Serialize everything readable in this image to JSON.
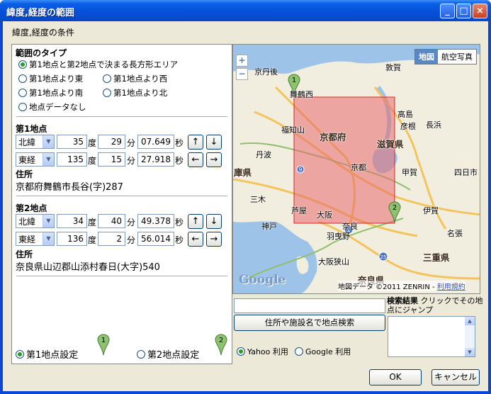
{
  "window": {
    "title": "緯度,経度の範囲"
  },
  "condition_label": "緯度,経度の条件",
  "range_type": {
    "title": "範囲のタイプ",
    "options": [
      {
        "label": "第1地点と第2地点で決まる長方形エリア",
        "selected": true
      },
      {
        "label": "第1地点より東",
        "selected": false
      },
      {
        "label": "第1地点より西",
        "selected": false
      },
      {
        "label": "第1地点より南",
        "selected": false
      },
      {
        "label": "第1地点より北",
        "selected": false
      },
      {
        "label": "地点データなし",
        "selected": false
      }
    ]
  },
  "point1": {
    "title": "第1地点",
    "lat": {
      "dir": "北緯",
      "deg": "35",
      "min": "29",
      "sec": "07.649"
    },
    "lon": {
      "dir": "東経",
      "deg": "135",
      "min": "15",
      "sec": "27.918"
    },
    "address_label": "住所",
    "address": "京都府舞鶴市長谷(字)287"
  },
  "point2": {
    "title": "第2地点",
    "lat": {
      "dir": "北緯",
      "deg": "34",
      "min": "40",
      "sec": "49.378"
    },
    "lon": {
      "dir": "東経",
      "deg": "136",
      "min": "2",
      "sec": "56.014"
    },
    "address_label": "住所",
    "address": "奈良県山辺郡山添村春日(大字)540"
  },
  "units": {
    "deg": "度",
    "min": "分",
    "sec": "秒"
  },
  "arrows": {
    "up": "↑",
    "down": "↓",
    "left": "←",
    "right": "→"
  },
  "point_mode": {
    "p1_label": "第1地点設定",
    "p1_selected": true,
    "p1_marker": "1",
    "p2_label": "第2地点設定",
    "p2_selected": false,
    "p2_marker": "2"
  },
  "map": {
    "type_tabs": [
      "地図",
      "航空写真"
    ],
    "active_tab": "地図",
    "zoom_in": "+",
    "zoom_out": "−",
    "labels": [
      "京丹後",
      "敦賀",
      "舞鶴西",
      "高島",
      "彦根",
      "長浜",
      "福知山",
      "京都府",
      "滋賀県",
      "丹波",
      "京都",
      "庫県",
      "甲賀",
      "四日市",
      "三木",
      "芦屋",
      "大阪",
      "伊賀",
      "神戸",
      "羽曳野",
      "奈良",
      "名張",
      "大阪狭山",
      "三重県",
      "奈良県"
    ],
    "road_numbers": [
      "9",
      "1",
      "25"
    ],
    "copyright": "地図データ ©2011 ZENRIN - ",
    "terms": "利用規約",
    "logo": "Google"
  },
  "search": {
    "input_value": "",
    "button_label": "住所や施設名で地点検索",
    "results_label_bold": "検索結果",
    "results_label_rest": " クリックでその地点にジャンプ",
    "engine_yahoo": "Yahoo 利用",
    "engine_google": "Google 利用",
    "engine_selected": "Yahoo"
  },
  "buttons": {
    "ok": "OK",
    "cancel": "キャンセル"
  },
  "colors": {
    "title_bar": "#0a5ee6",
    "selection_rect": "#e8696d",
    "marker": "#8dc26f"
  }
}
